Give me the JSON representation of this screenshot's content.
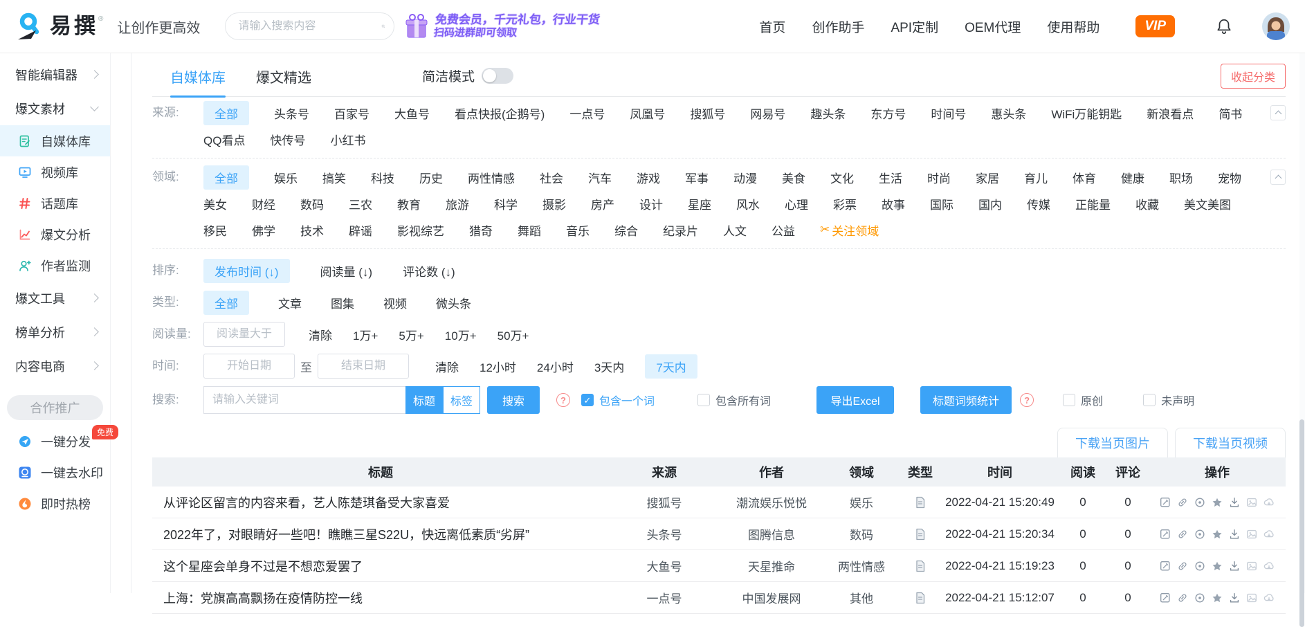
{
  "colors": {
    "primary": "#3ba3f7",
    "active_chip_bg": "#e0f2fe",
    "vip_orange": "#ff6e02",
    "danger_red": "#f56c6c",
    "badge_red": "#f5483b",
    "promo_purple": "#7d5ef5",
    "follow_orange": "#ff9800",
    "table_header_bg": "#eff2f5"
  },
  "icons": {
    "logo-icon": "blue pen-nib 9 mark",
    "search-icon": "magnifier",
    "gift-icon": "purple gift box",
    "bell-icon": "bell outline",
    "selfmedia-icon": "green document",
    "video-icon": "blue monitor with play",
    "topic-icon": "red hash",
    "analysis-icon": "red line chart",
    "author-icon": "teal person with plus",
    "dispatch-icon": "blue paper plane circle",
    "watermark-icon": "blue lens square",
    "hot-icon": "orange flame circle",
    "scissors-icon": "✂",
    "help-icon": "? in red circle",
    "doc-type-icon": "grey page",
    "actions": [
      "edit",
      "link",
      "disc",
      "star",
      "download",
      "image",
      "cloud-download"
    ]
  },
  "header": {
    "logo_text": "易撰",
    "logo_reg": "®",
    "tagline": "让创作更高效",
    "search_placeholder": "请输入搜索内容",
    "promo_line1": "免费会员，千元礼包，行业干货",
    "promo_line2": "扫码进群即可领取",
    "nav": [
      "首页",
      "创作助手",
      "API定制",
      "OEM代理",
      "使用帮助"
    ],
    "vip": "VIP"
  },
  "sidebar": {
    "smart_editor": "智能编辑器",
    "material": "爆文素材",
    "submenu": [
      {
        "label": "自媒体库",
        "active": true
      },
      {
        "label": "视频库"
      },
      {
        "label": "话题库"
      },
      {
        "label": "爆文分析"
      },
      {
        "label": "作者监测"
      }
    ],
    "tools": "爆文工具",
    "rank": "榜单分析",
    "ecommerce": "内容电商",
    "promo_header": "合作推广",
    "dispatch": "一键分发",
    "dispatch_badge": "免费",
    "watermark": "一键去水印",
    "hotlist": "即时热榜"
  },
  "content": {
    "tabs": {
      "tab1": "自媒体库",
      "tab2": "爆文精选",
      "mode_label": "简洁模式",
      "collapse": "收起分类"
    },
    "filters": {
      "source_label": "来源:",
      "source_rows_0": [
        {
          "t": "全部",
          "a": 1
        },
        "头条号",
        "百家号",
        "大鱼号",
        "看点快报(企鹅号)",
        "一点号",
        "凤凰号",
        "搜狐号",
        "网易号",
        "趣头条",
        "东方号",
        "时间号",
        "惠头条",
        "WiFi万能钥匙",
        "新浪看点",
        "简书"
      ],
      "source_rows_1": [
        "QQ看点",
        "快传号",
        "小红书"
      ],
      "field_label": "领域:",
      "field_rows_0": [
        {
          "t": "全部",
          "a": 1
        },
        "娱乐",
        "搞笑",
        "科技",
        "历史",
        "两性情感",
        "社会",
        "汽车",
        "游戏",
        "军事",
        "动漫",
        "美食",
        "文化",
        "生活",
        "时尚",
        "家居",
        "育儿",
        "体育",
        "健康",
        "职场",
        "宠物"
      ],
      "field_rows_1": [
        "美女",
        "财经",
        "数码",
        "三农",
        "教育",
        "旅游",
        "科学",
        "摄影",
        "房产",
        "设计",
        "星座",
        "风水",
        "心理",
        "彩票",
        "故事",
        "国际",
        "国内",
        "传媒",
        "正能量",
        "收藏",
        "美文美图"
      ],
      "field_rows_2": [
        "移民",
        "佛学",
        "技术",
        "辟谣",
        "影视综艺",
        "猎奇",
        "舞蹈",
        "音乐",
        "综合",
        "纪录片",
        "人文",
        "公益"
      ],
      "follow_field": "关注领域",
      "sort_label": "排序:",
      "sort_items": [
        {
          "t": "发布时间 (↓)",
          "a": 1
        },
        "阅读量 (↓)",
        "评论数 (↓)"
      ],
      "type_label": "类型:",
      "type_items": [
        {
          "t": "全部",
          "a": 1
        },
        "文章",
        "图集",
        "视频",
        "微头条"
      ],
      "reads_label": "阅读量:",
      "reads_placeholder": "阅读量大于",
      "reads_items": [
        "清除",
        "1万+",
        "5万+",
        "10万+",
        "50万+"
      ],
      "time_label": "时间:",
      "time_start_placeholder": "开始日期",
      "time_to": "至",
      "time_end_placeholder": "结束日期",
      "time_items": [
        "清除",
        "12小时",
        "24小时",
        "3天内",
        {
          "t": "7天内",
          "a": 1
        }
      ],
      "search_label": "搜索:",
      "search_placeholder": "请输入关键词",
      "btn_title": "标题",
      "btn_tag": "标签",
      "btn_search": "搜索",
      "chk_one_word": "包含一个词",
      "chk_all_words": "包含所有词",
      "btn_excel": "导出Excel",
      "btn_freq": "标题词频统计",
      "chk_original": "原创",
      "chk_undeclared": "未声明"
    },
    "table": {
      "btn_download_images": "下载当页图片",
      "btn_download_videos": "下载当页视频",
      "headers": [
        "标题",
        "来源",
        "作者",
        "领域",
        "类型",
        "时间",
        "阅读",
        "评论",
        "操作"
      ],
      "rows": [
        {
          "title": "从评论区留言的内容来看，艺人陈楚琪备受大家喜爱",
          "source": "搜狐号",
          "author": "潮流娱乐悦悦",
          "field": "娱乐",
          "time": "2022-04-21 15:20:49",
          "reads": "0",
          "comments": "0"
        },
        {
          "title": "2022年了，对眼睛好一些吧！瞧瞧三星S22U，快远离低素质“劣屏”",
          "source": "头条号",
          "author": "图腾信息",
          "field": "数码",
          "time": "2022-04-21 15:20:34",
          "reads": "0",
          "comments": "0"
        },
        {
          "title": "这个星座会单身不过是不想恋爱罢了",
          "source": "大鱼号",
          "author": "天星推命",
          "field": "两性情感",
          "time": "2022-04-21 15:19:23",
          "reads": "0",
          "comments": "0"
        },
        {
          "title": "上海：党旗高高飘扬在疫情防控一线",
          "source": "一点号",
          "author": "中国发展网",
          "field": "其他",
          "time": "2022-04-21 15:12:07",
          "reads": "0",
          "comments": "0"
        }
      ]
    }
  }
}
